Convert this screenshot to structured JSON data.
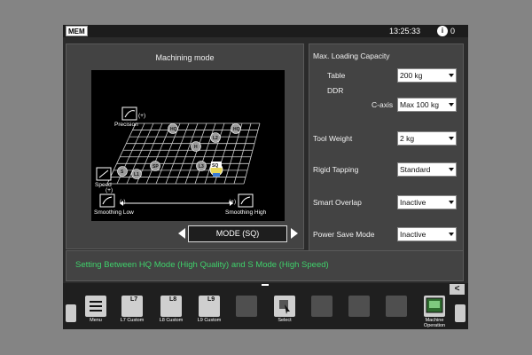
{
  "topbar": {
    "mode_badge": "MEM",
    "time": "13:25:33",
    "info_icon": "i",
    "alarm_count": "0"
  },
  "machining": {
    "title": "Machining mode",
    "axes": {
      "precision_label": "Precision",
      "precision_sign": "(+)",
      "speed_label": "Speed",
      "speed_sign": "(+)",
      "smoothing_low_label": "Smoothing Low",
      "smoothing_low_sign": "(-)",
      "smoothing_high_label": "Smoothing High",
      "smoothing_high_sign": "(+)"
    },
    "nodes": [
      "S",
      "L1",
      "SP",
      "HQ",
      "H",
      "L2",
      "HQ",
      "L3"
    ],
    "current_mode_badge": "SQ",
    "mode_button": "MODE (SQ)"
  },
  "settings": {
    "max_loading_label": "Max. Loading Capacity",
    "table_label": "Table",
    "table_value": "200 kg",
    "ddr_label": "DDR",
    "c_axis_label": "C-axis",
    "c_axis_value": "Max 100 kg",
    "tool_weight_label": "Tool Weight",
    "tool_weight_value": "2 kg",
    "rigid_tapping_label": "Rigid Tapping",
    "rigid_tapping_value": "Standard",
    "smart_overlap_label": "Smart Overlap",
    "smart_overlap_value": "Inactive",
    "power_save_label": "Power Save Mode",
    "power_save_value": "Inactive"
  },
  "message": "Setting Between HQ Mode (High Quality) and S Mode (High Speed)",
  "softkeys": [
    {
      "label": "Menu",
      "num": ""
    },
    {
      "label": "L7 Custom",
      "num": "L7"
    },
    {
      "label": "L8 Custom",
      "num": "L8"
    },
    {
      "label": "L9 Custom",
      "num": "L9"
    },
    {
      "label": "",
      "num": ""
    },
    {
      "label": "Select",
      "num": ""
    },
    {
      "label": "",
      "num": ""
    },
    {
      "label": "",
      "num": ""
    },
    {
      "label": "",
      "num": ""
    },
    {
      "label": "Machine Operation",
      "num": ""
    }
  ],
  "collapse_icon": "<"
}
